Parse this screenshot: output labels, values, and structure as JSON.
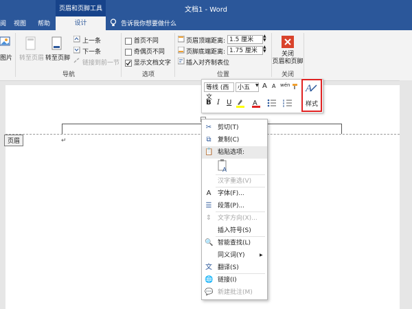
{
  "app": {
    "title": "文档1 - Word",
    "context_group": "页眉和页脚工具"
  },
  "tabs": {
    "t1": "阅",
    "t2": "视图",
    "t3": "帮助",
    "active": "设计",
    "tell_me": "告诉我你想要做什么"
  },
  "ribbon": {
    "pic_label": "图片",
    "goto_header": "转至页眉",
    "goto_footer": "转至页脚",
    "prev": "上一条",
    "next": "下一条",
    "link_prev": "链接到前一节",
    "nav_group": "导航",
    "opt_first": "首页不同",
    "opt_oddeven": "奇偶页不同",
    "opt_showtext": "显示文档文字",
    "options_group": "选项",
    "header_top_label": "页眉顶端距离:",
    "header_top_value": "1.5 厘米",
    "footer_bottom_label": "页脚底端距离:",
    "footer_bottom_value": "1.75 厘米",
    "insert_align_tab": "插入对齐制表位",
    "position_group": "位置",
    "close_label": "关闭\n页眉和页脚",
    "close_group": "关闭"
  },
  "document": {
    "header_tag": "页眉",
    "para_mark": "↵"
  },
  "mini_toolbar": {
    "font": "等线 (西文",
    "size": "小五",
    "grow": "A",
    "shrink": "A",
    "phonetic": "wén",
    "bold": "B",
    "italic": "I",
    "underline": "U",
    "styles": "样式"
  },
  "context_menu": {
    "cut": "剪切(T)",
    "copy": "复制(C)",
    "paste_options": "粘贴选项:",
    "hanzi": "汉字重选(V)",
    "font": "字体(F)...",
    "paragraph": "段落(P)...",
    "text_direction": "文字方向(X)...",
    "insert_symbol": "插入符号(S)",
    "smart_lookup": "智能查找(L)",
    "synonyms": "同义词(Y)",
    "translate": "翻译(S)",
    "link": "链接(I)",
    "new_comment": "新建批注(M)"
  },
  "colors": {
    "accent": "#2b579a",
    "highlight": "#ffff00",
    "font_red": "#e02020"
  }
}
